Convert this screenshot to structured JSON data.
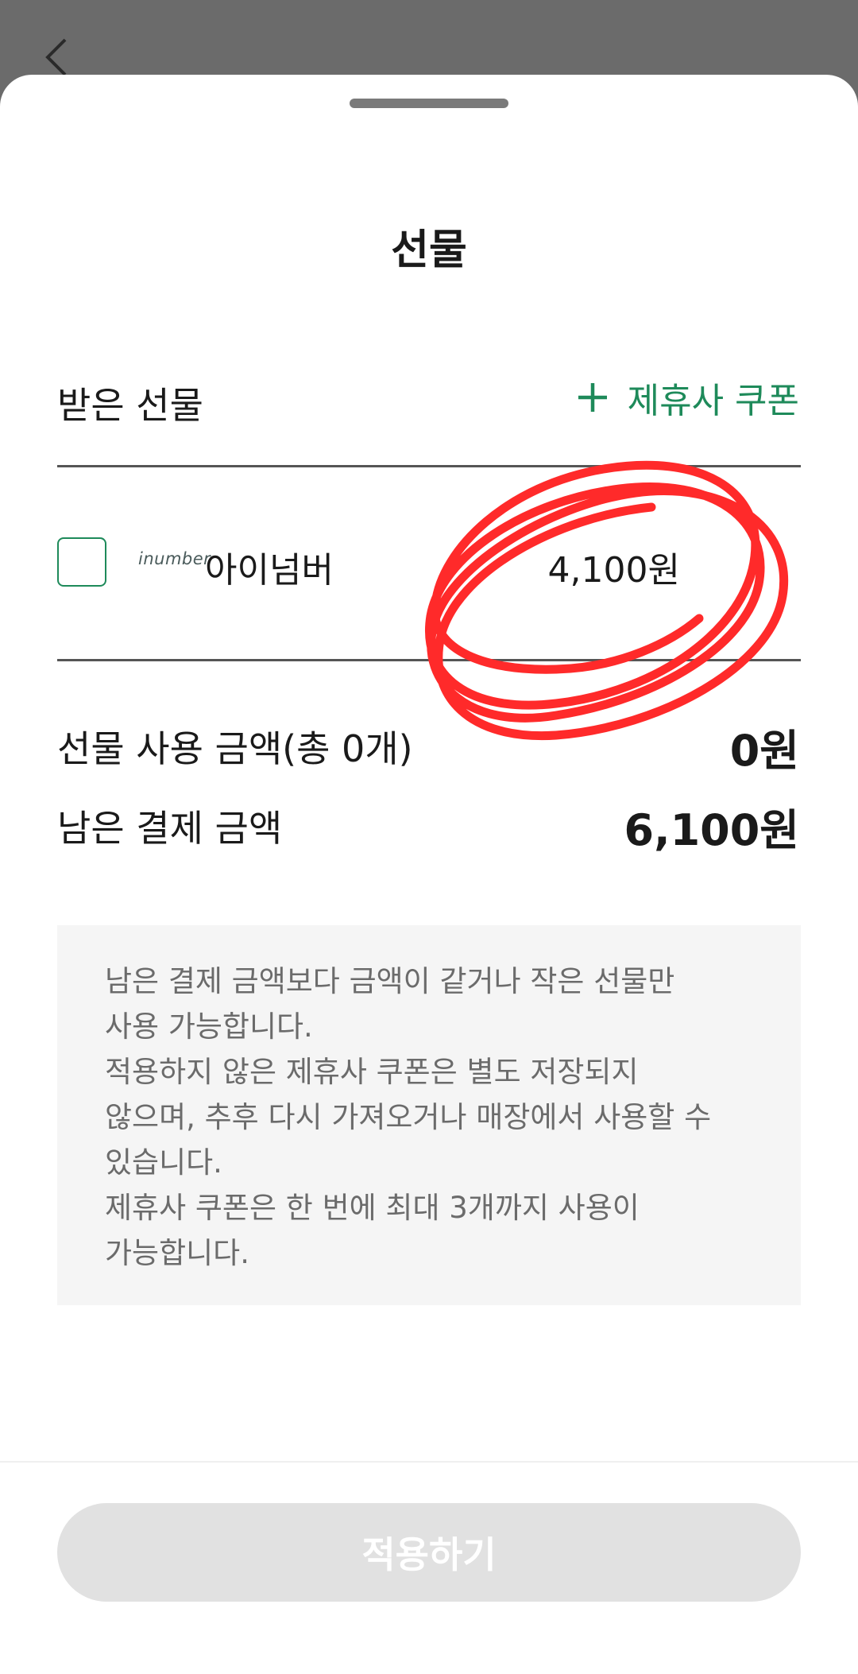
{
  "header": {
    "back_icon": "chevron-left-icon"
  },
  "sheet": {
    "title": "선물",
    "section_label": "받은 선물",
    "coupon_button": {
      "icon": "plus-icon",
      "label": "제휴사 쿠폰"
    }
  },
  "gift": {
    "checked": false,
    "brand_logo": "inumber",
    "name": "아이넘버",
    "amount": "4,100원"
  },
  "summary": {
    "used_label": "선물 사용 금액(총 0개)",
    "used_value": "0원",
    "remaining_label": "남은 결제 금액",
    "remaining_value": "6,100원"
  },
  "notice": {
    "text": "남은 결제 금액보다 금액이 같거나 작은 선물만\n사용 가능합니다.\n적용하지 않은 제휴사 쿠폰은 별도 저장되지\n않으며, 추후 다시 가져오거나 매장에서 사용할 수\n있습니다.\n제휴사 쿠폰은 한 번에 최대 3개까지 사용이\n가능합니다."
  },
  "footer": {
    "apply_label": "적용하기",
    "apply_enabled": false
  },
  "colors": {
    "accent": "#1e8a5a",
    "annotation": "#ff2a2a",
    "disabled_button": "#e1e1e1"
  }
}
